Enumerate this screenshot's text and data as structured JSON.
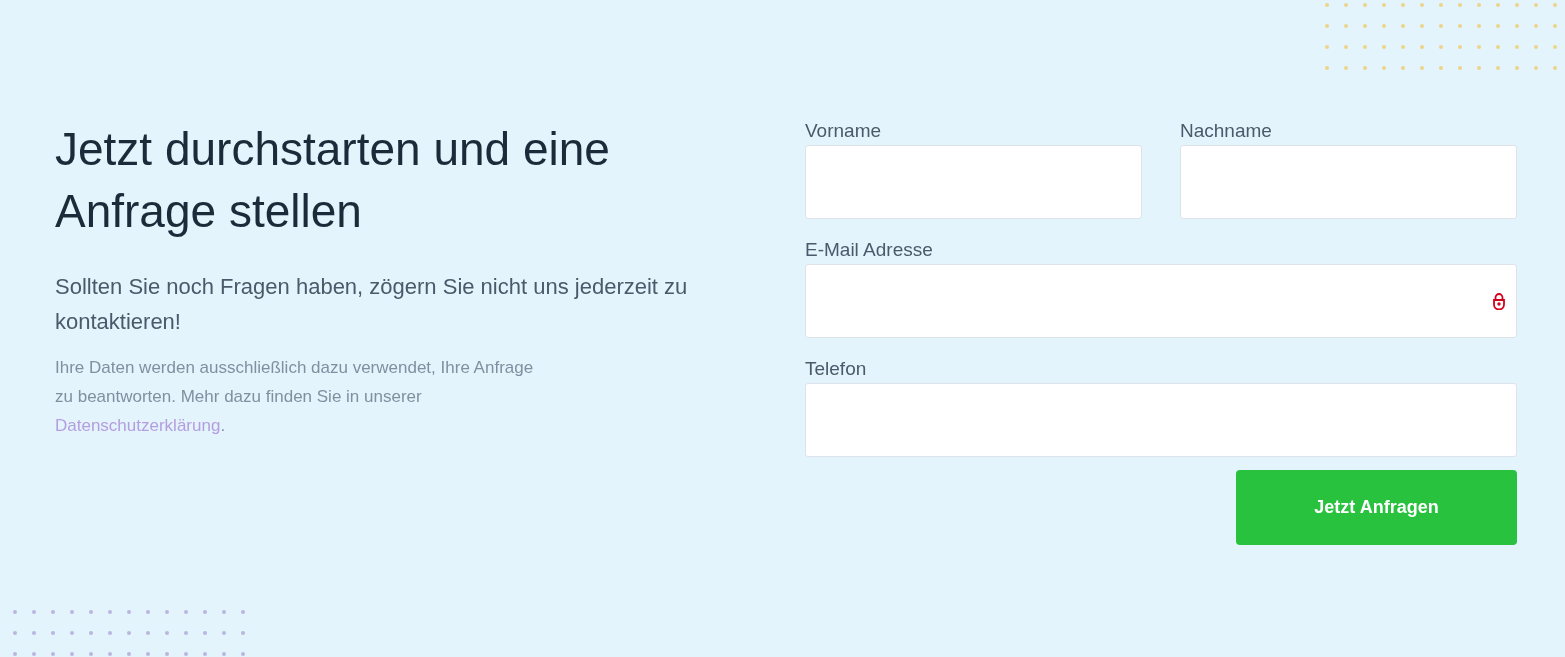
{
  "intro": {
    "heading": "Jetzt durchstarten und eine Anfrage stellen",
    "lead": "Sollten Sie noch Fragen haben, zögern Sie nicht uns jederzeit zu kontaktieren!",
    "privacy": {
      "text": "Ihre Daten werden ausschließlich dazu verwendet, Ihre Anfrage zu beantworten. Mehr dazu finden Sie in unserer",
      "link": "Datenschutzerklärung",
      "after": "."
    }
  },
  "form": {
    "rows": [
      [
        {
          "label": "Vorname",
          "kind": "plain"
        },
        {
          "label": "Nachname",
          "kind": "plain"
        }
      ],
      [
        {
          "label": "E-Mail Adresse",
          "kind": "secured"
        }
      ],
      [
        {
          "label": "Telefon",
          "kind": "plain"
        }
      ]
    ],
    "submit": "Jetzt Anfragen"
  }
}
